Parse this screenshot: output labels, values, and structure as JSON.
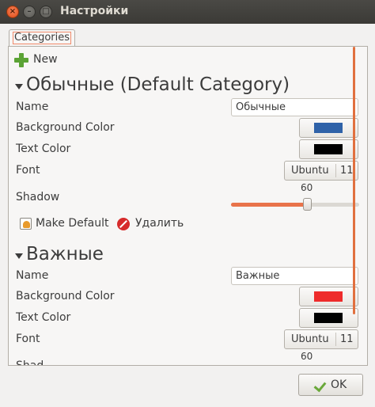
{
  "window": {
    "title": "Настройки"
  },
  "tabs": [
    {
      "label": "Categories"
    }
  ],
  "toolbar": {
    "new_label": "New"
  },
  "categories": [
    {
      "title": "Обычные (Default Category)",
      "name_label": "Name",
      "name_value": "Обычные",
      "bg_label": "Background Color",
      "bg_color": "#2f62a8",
      "text_label": "Text Color",
      "text_color": "#000000",
      "font_label": "Font",
      "font_name": "Ubuntu",
      "font_size": "11",
      "shadow_label": "Shadow",
      "shadow_value": "60",
      "shadow_max": 100,
      "make_default_label": "Make Default",
      "delete_label": "Удалить"
    },
    {
      "title": "Важные",
      "name_label": "Name",
      "name_value": "Важные",
      "bg_label": "Background Color",
      "bg_color": "#ee2b2b",
      "text_label": "Text Color",
      "text_color": "#000000",
      "font_label": "Font",
      "font_name": "Ubuntu",
      "font_size": "11",
      "shadow_label": "Shad",
      "shadow_value": "60"
    }
  ],
  "footer": {
    "ok_label": "OK"
  },
  "colors": {
    "accent": "#e1703f"
  }
}
